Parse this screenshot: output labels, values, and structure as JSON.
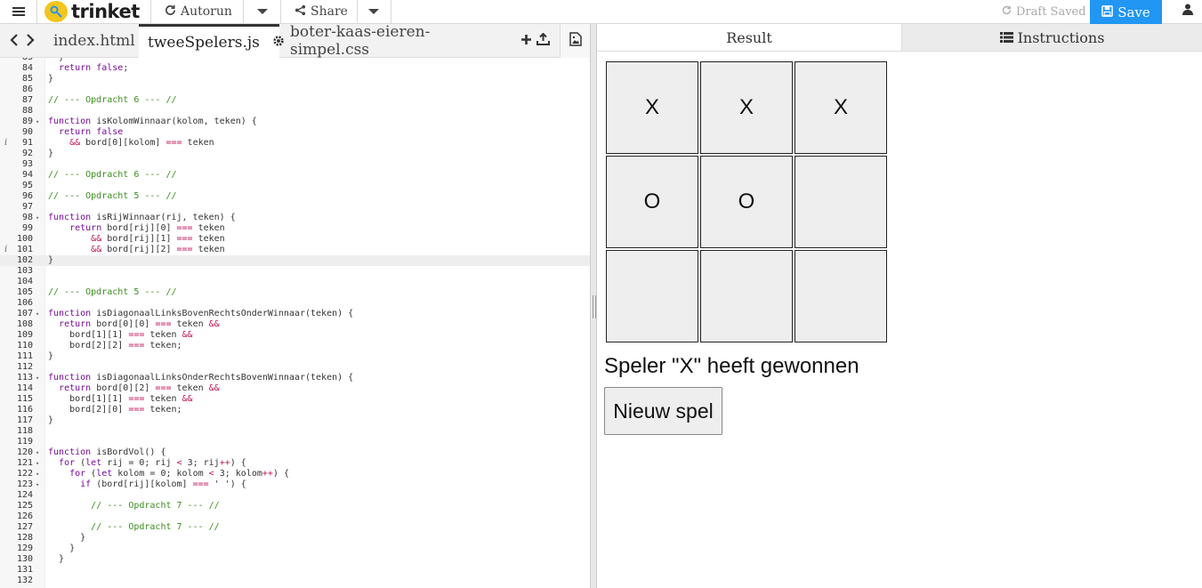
{
  "topbar": {
    "logo_text": "trinket",
    "autorun_label": "Autorun",
    "share_label": "Share",
    "draft_status": "Draft Saved",
    "save_label": "Save"
  },
  "editor_tabs": [
    {
      "label": "index.html"
    },
    {
      "label": "tweeSpelers.js"
    },
    {
      "label": "boter-kaas-eieren-simpel.css"
    }
  ],
  "right_tabs": {
    "result": "Result",
    "instructions": "Instructions"
  },
  "code_lines": [
    {
      "n": "83",
      "t": "  }"
    },
    {
      "n": "84",
      "t": "  return false;"
    },
    {
      "n": "85",
      "t": "}"
    },
    {
      "n": "86",
      "t": ""
    },
    {
      "n": "87",
      "t": "// --- Opdracht 6 --- //"
    },
    {
      "n": "88",
      "t": ""
    },
    {
      "n": "89",
      "t": "function isKolomWinnaar(kolom, teken) {",
      "fold": true
    },
    {
      "n": "90",
      "t": "  return false"
    },
    {
      "n": "91",
      "t": "    && bord[0][kolom] === teken",
      "info": true
    },
    {
      "n": "92",
      "t": "}"
    },
    {
      "n": "93",
      "t": ""
    },
    {
      "n": "94",
      "t": "// --- Opdracht 6 --- //"
    },
    {
      "n": "95",
      "t": ""
    },
    {
      "n": "96",
      "t": "// --- Opdracht 5 --- //"
    },
    {
      "n": "97",
      "t": ""
    },
    {
      "n": "98",
      "t": "function isRijWinnaar(rij, teken) {",
      "fold": true
    },
    {
      "n": "99",
      "t": "    return bord[rij][0] === teken"
    },
    {
      "n": "100",
      "t": "        && bord[rij][1] === teken"
    },
    {
      "n": "101",
      "t": "        && bord[rij][2] === teken",
      "info": true
    },
    {
      "n": "102",
      "t": "}",
      "hl": true
    },
    {
      "n": "103",
      "t": ""
    },
    {
      "n": "104",
      "t": ""
    },
    {
      "n": "105",
      "t": "// --- Opdracht 5 --- //"
    },
    {
      "n": "106",
      "t": ""
    },
    {
      "n": "107",
      "t": "function isDiagonaalLinksBovenRechtsOnderWinnaar(teken) {",
      "fold": true
    },
    {
      "n": "108",
      "t": "  return bord[0][0] === teken &&"
    },
    {
      "n": "109",
      "t": "    bord[1][1] === teken &&"
    },
    {
      "n": "110",
      "t": "    bord[2][2] === teken;"
    },
    {
      "n": "111",
      "t": "}"
    },
    {
      "n": "112",
      "t": ""
    },
    {
      "n": "113",
      "t": "function isDiagonaalLinksOnderRechtsBovenWinnaar(teken) {",
      "fold": true
    },
    {
      "n": "114",
      "t": "  return bord[0][2] === teken &&"
    },
    {
      "n": "115",
      "t": "    bord[1][1] === teken &&"
    },
    {
      "n": "116",
      "t": "    bord[2][0] === teken;"
    },
    {
      "n": "117",
      "t": "}"
    },
    {
      "n": "118",
      "t": ""
    },
    {
      "n": "119",
      "t": ""
    },
    {
      "n": "120",
      "t": "function isBordVol() {",
      "fold": true
    },
    {
      "n": "121",
      "t": "  for (let rij = 0; rij < 3; rij++) {",
      "fold": true
    },
    {
      "n": "122",
      "t": "    for (let kolom = 0; kolom < 3; kolom++) {",
      "fold": true
    },
    {
      "n": "123",
      "t": "      if (bord[rij][kolom] === ' ') {",
      "fold": true
    },
    {
      "n": "124",
      "t": ""
    },
    {
      "n": "125",
      "t": "        // --- Opdracht 7 --- //"
    },
    {
      "n": "126",
      "t": ""
    },
    {
      "n": "127",
      "t": "        // --- Opdracht 7 --- //"
    },
    {
      "n": "128",
      "t": "      }"
    },
    {
      "n": "129",
      "t": "    }"
    },
    {
      "n": "130",
      "t": "  }"
    },
    {
      "n": "131",
      "t": ""
    },
    {
      "n": "132",
      "t": ""
    }
  ],
  "board": [
    "X",
    "X",
    "X",
    "O",
    "O",
    "",
    "",
    "",
    ""
  ],
  "status_text": "Speler \"X\" heeft gewonnen",
  "new_game_label": "Nieuw spel"
}
